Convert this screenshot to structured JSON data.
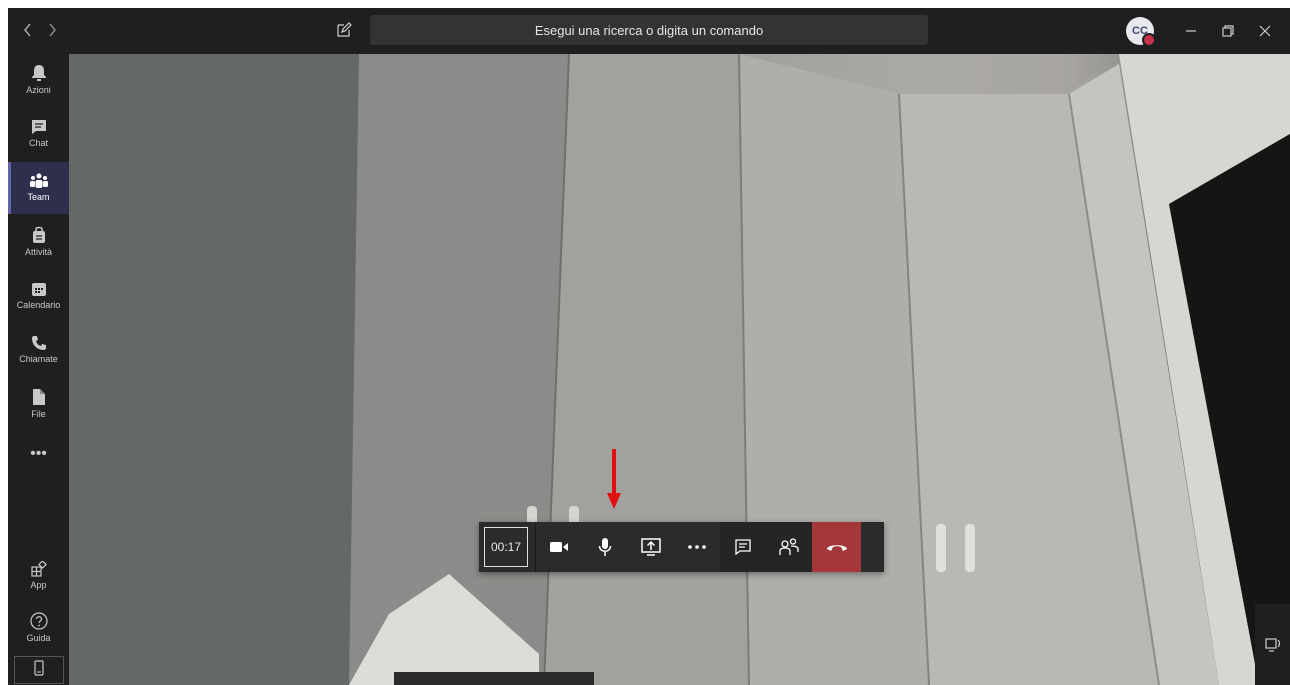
{
  "titlebar": {
    "search_placeholder": "Esegui una ricerca o digita un comando",
    "avatar_initials": "CC",
    "presence_color": "#c4314b"
  },
  "rail": {
    "items": [
      {
        "label": "Azioni",
        "icon": "bell-icon"
      },
      {
        "label": "Chat",
        "icon": "chat-icon"
      },
      {
        "label": "Team",
        "icon": "team-icon",
        "active": true
      },
      {
        "label": "Attività",
        "icon": "assignments-icon"
      },
      {
        "label": "Calendario",
        "icon": "calendar-icon"
      },
      {
        "label": "Chiamate",
        "icon": "phone-icon"
      },
      {
        "label": "File",
        "icon": "file-icon"
      },
      {
        "label": "•••",
        "icon": "more-icon"
      }
    ],
    "bottom": [
      {
        "label": "App",
        "icon": "apps-icon"
      },
      {
        "label": "Guida",
        "icon": "help-icon"
      },
      {
        "label": "",
        "icon": "device-icon"
      }
    ]
  },
  "call": {
    "timer": "00:17",
    "accent_color": "#a4373a"
  },
  "colors": {
    "brand": "#6264a7",
    "arrow": "#e01010"
  }
}
